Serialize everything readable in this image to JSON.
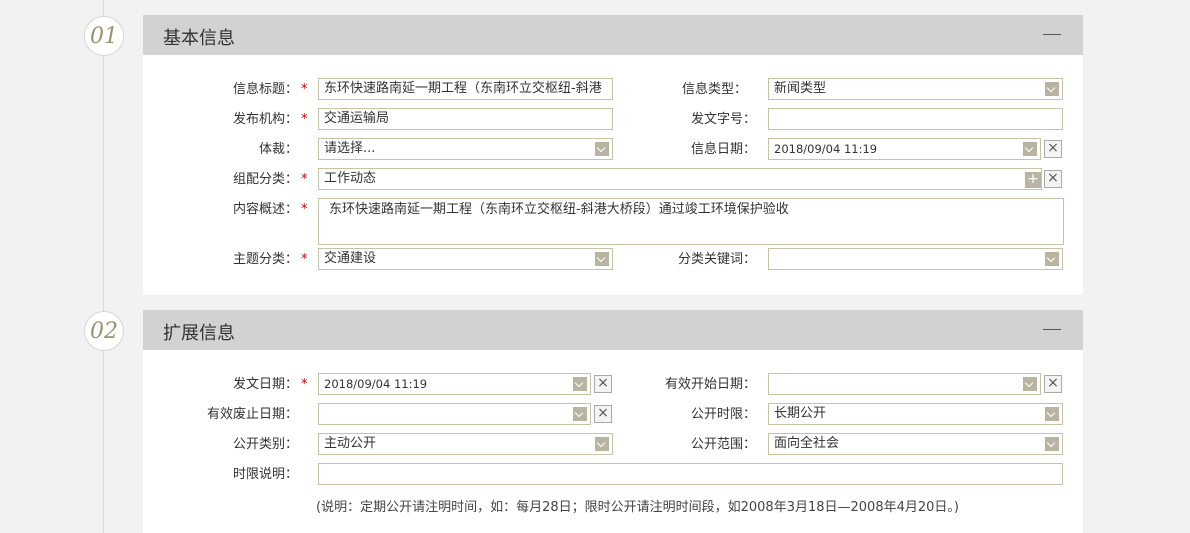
{
  "sections": [
    {
      "number": "01",
      "title": "基本信息"
    },
    {
      "number": "02",
      "title": "扩展信息"
    }
  ],
  "basic": {
    "info_title_label": "信息标题：",
    "info_title_value": "东环快速路南延一期工程（东南环立交枢纽-斜港",
    "info_type_label": "信息类型：",
    "info_type_value": "新闻类型",
    "publisher_label": "发布机构：",
    "publisher_value": "交通运输局",
    "doc_no_label": "发文字号：",
    "doc_no_value": "",
    "genre_label": "体裁：",
    "genre_value": "请选择...",
    "info_date_label": "信息日期：",
    "info_date_value": "2018/09/04 11:19",
    "group_label": "组配分类：",
    "group_value": "工作动态",
    "summary_label": "内容概述：",
    "summary_value": "东环快速路南延一期工程（东南环立交枢纽-斜港大桥段）通过竣工环境保护验收",
    "topic_label": "主题分类：",
    "topic_value": "交通建设",
    "keyword_label": "分类关键词：",
    "keyword_value": ""
  },
  "extended": {
    "issue_date_label": "发文日期：",
    "issue_date_value": "2018/09/04 11:19",
    "valid_start_label": "有效开始日期：",
    "valid_start_value": "",
    "valid_end_label": "有效废止日期：",
    "valid_end_value": "",
    "public_period_label": "公开时限：",
    "public_period_value": "长期公开",
    "public_type_label": "公开类别：",
    "public_type_value": "主动公开",
    "public_scope_label": "公开范围：",
    "public_scope_value": "面向全社会",
    "period_desc_label": "时限说明：",
    "period_desc_value": "",
    "note": "(说明：定期公开请注明时间，如：每月28日；限时公开请注明时间段，如2008年3月18日—2008年4月20日。)"
  },
  "icons": {
    "required_mark": "*",
    "clear": "×",
    "add": "+"
  },
  "colors": {
    "header_bg": "#d2d2d2",
    "field_border": "#c9c2a4",
    "dropdown_btn": "#b9b3a2",
    "required": "#c40000",
    "step_number": "#9a9270"
  }
}
